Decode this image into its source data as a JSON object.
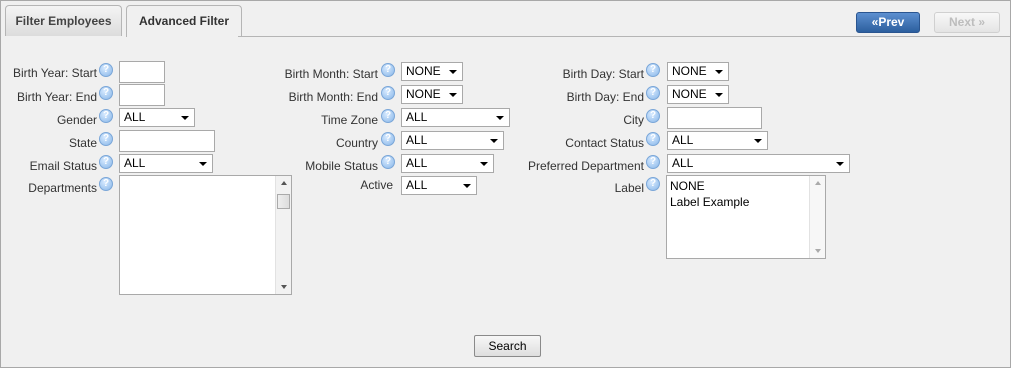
{
  "tabs": [
    {
      "label": "Filter Employees",
      "active": false
    },
    {
      "label": "Advanced Filter",
      "active": true
    }
  ],
  "nav": {
    "prev_label": "«Prev",
    "next_label": "Next »"
  },
  "fields": {
    "birth_year_start": {
      "label": "Birth Year: Start",
      "value": ""
    },
    "birth_year_end": {
      "label": "Birth Year: End",
      "value": ""
    },
    "gender": {
      "label": "Gender",
      "value": "ALL"
    },
    "state": {
      "label": "State",
      "value": ""
    },
    "email_status": {
      "label": "Email Status",
      "value": "ALL"
    },
    "departments": {
      "label": "Departments",
      "options": []
    },
    "birth_month_start": {
      "label": "Birth Month: Start",
      "value": "NONE"
    },
    "birth_month_end": {
      "label": "Birth Month: End",
      "value": "NONE"
    },
    "time_zone": {
      "label": "Time Zone",
      "value": "ALL"
    },
    "country": {
      "label": "Country",
      "value": "ALL"
    },
    "mobile_status": {
      "label": "Mobile Status",
      "value": "ALL"
    },
    "active": {
      "label": "Active",
      "value": "ALL"
    },
    "birth_day_start": {
      "label": "Birth Day: Start",
      "value": "NONE"
    },
    "birth_day_end": {
      "label": "Birth Day: End",
      "value": "NONE"
    },
    "city": {
      "label": "City",
      "value": ""
    },
    "contact_status": {
      "label": "Contact Status",
      "value": "ALL"
    },
    "preferred_department": {
      "label": "Preferred Department",
      "value": "ALL"
    },
    "label": {
      "label": "Label",
      "options": [
        "NONE",
        "Label Example"
      ]
    }
  },
  "help_icon": "question-circle-icon",
  "search_label": "Search",
  "colors": {
    "prev_button": "#2c5f9e",
    "panel_background": "#f0f0f0",
    "help_icon": "#88b6e8"
  }
}
